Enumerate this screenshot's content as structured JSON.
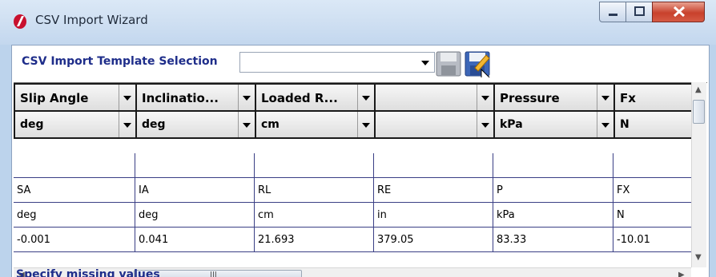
{
  "window": {
    "title": "CSV Import Wizard",
    "icon": "app-logo-icon",
    "controls": [
      "minimize-icon",
      "maximize-icon",
      "close-icon"
    ]
  },
  "toolbar": {
    "template_label": "CSV Import Template Selection",
    "template_select_value": "",
    "save_icon": "save-disk-icon",
    "save_as_icon": "save-edit-icon"
  },
  "grid": {
    "columns": [
      {
        "header": "Slip Angle",
        "unit": "deg"
      },
      {
        "header": "Inclinatio...",
        "unit": "deg"
      },
      {
        "header": "Loaded R...",
        "unit": "cm"
      },
      {
        "header": "",
        "unit": ""
      },
      {
        "header": "Pressure",
        "unit": "kPa"
      },
      {
        "header": "Fx",
        "unit": "N"
      }
    ],
    "rows": [
      [
        "",
        "",
        "",
        "",
        "",
        ""
      ],
      [
        "SA",
        "IA",
        "RL",
        "RE",
        "P",
        "FX"
      ],
      [
        "deg",
        "deg",
        "cm",
        "in",
        "kPa",
        "N"
      ],
      [
        "-0.001",
        "0.041",
        "21.693",
        "379.05",
        "83.33",
        "-10.01"
      ]
    ]
  },
  "scrollbars": {
    "h_grip": "III"
  },
  "footer": {
    "label": "Specify missing values"
  },
  "colors": {
    "label_blue": "#1e2d8a",
    "grid_line": "#3a3f85",
    "title_bar": "#c3d7ee"
  }
}
